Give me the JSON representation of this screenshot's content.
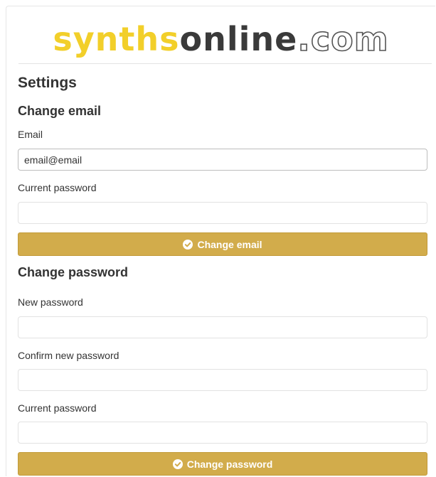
{
  "logo": {
    "part1": "synths",
    "part2": "online",
    "part3": ".com"
  },
  "page": {
    "title": "Settings"
  },
  "change_email": {
    "heading": "Change email",
    "email_label": "Email",
    "email_value": "email@email",
    "current_password_label": "Current password",
    "current_password_value": "",
    "button_label": "Change email",
    "button_icon": "check-circle-icon"
  },
  "change_password": {
    "heading": "Change password",
    "new_password_label": "New password",
    "new_password_value": "",
    "confirm_password_label": "Confirm new password",
    "confirm_password_value": "",
    "current_password_label": "Current password",
    "current_password_value": "",
    "button_label": "Change password",
    "button_icon": "check-circle-icon"
  },
  "colors": {
    "accent": "#d2ac4b",
    "logo_yellow": "#f2cf2a",
    "logo_dark": "#3a3a3a"
  }
}
